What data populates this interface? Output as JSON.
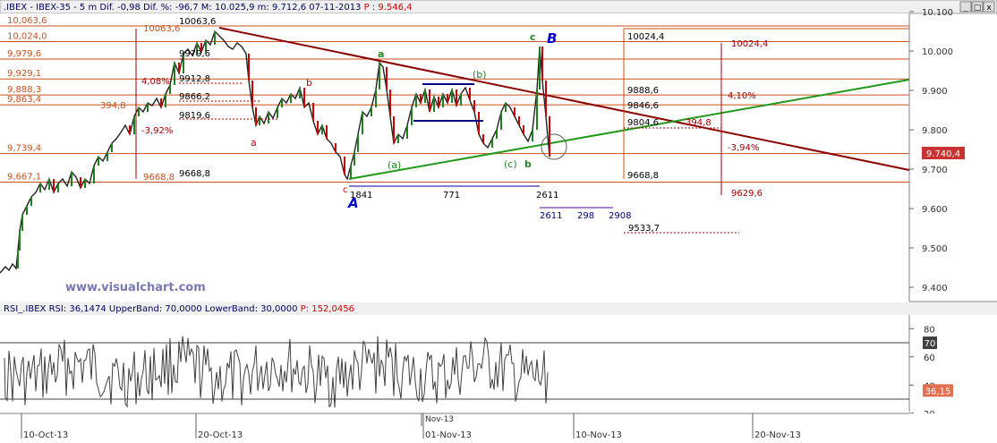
{
  "header": {
    "symbol": ".IBEX - IBEX-35",
    "timeframe": "5 m",
    "dif_label": "Dif.",
    "dif_value": "-0,98",
    "dif_pct_label": "Dif. %:",
    "dif_pct": "-96,7",
    "max_label": "M:",
    "max": "10.025,9",
    "min_label": "m:",
    "min": "9.712,6",
    "date": "07-11-2013",
    "p_label": "P :",
    "price": "9.546,4"
  },
  "window_buttons": [
    "_",
    "□",
    "x"
  ],
  "colors": {
    "up": "#0000c8",
    "down": "#c80000",
    "trend_red": "#8b0000",
    "trend_green": "#22991a",
    "axis_price": "#c83232",
    "watermark": "#7878b4"
  },
  "watermark": "www.visualchart.com",
  "price_axis": {
    "ticks": [
      "10.100",
      "10.000",
      "9.900",
      "9.800",
      "9.700",
      "9.600",
      "9.500",
      "9.400"
    ],
    "tick_values": [
      10100,
      10000,
      9900,
      9800,
      9700,
      9600,
      9500,
      9400
    ],
    "current": "9.740,4"
  },
  "date_axis": {
    "labels": [
      "10-Oct-13",
      "20-Oct-13",
      "01-Nov-13",
      "10-Nov-13",
      "20-Nov-13"
    ],
    "sub_label": "Nov-13"
  },
  "hlevels": [
    {
      "label": "10,063,6",
      "value": 10063.6
    },
    {
      "label": "10,024,0",
      "value": 10024.0
    },
    {
      "label": "9,979,6",
      "value": 9979.6
    },
    {
      "label": "9,929,1",
      "value": 9929.1
    },
    {
      "label": "9,888,3",
      "value": 9888.3
    },
    {
      "label": "9,863,4",
      "value": 9863.4
    },
    {
      "label": "9,739,4",
      "value": 9739.4
    },
    {
      "label": "9,667,1",
      "value": 9667.1
    }
  ],
  "annotations": {
    "l_10063": "10063,6",
    "l_10063b": "10063,6",
    "l_997": "9979,6",
    "l_9912": "9912,8",
    "l_9866": "9866,2",
    "l_9819": "9819,6",
    "l_9668": "9668,8",
    "l_9668b": "9668,8",
    "l_3948": "394,8",
    "l_408": "4,08%",
    "l_392": "-3,92%",
    "r_10024": "10024,4",
    "r_10024b": "10024,4",
    "r_9888": "9888,6",
    "r_410": "4,10%",
    "r_9846": "9846,6",
    "r_9804": "9804,6",
    "r_3948": "394,8",
    "r_394": "-3,94%",
    "r_9668": "9668,8",
    "r_9629": "9629,6",
    "r_9533": "9533,7",
    "m_1841": "1841",
    "m_771": "771",
    "m_2611": "2611",
    "m_2611b": "2611",
    "m_298": "298",
    "m_2908": "2908",
    "w_a": "a",
    "w_b": "b",
    "w_c": "c",
    "w_A": "A",
    "w_B": "B",
    "w_ga": "a",
    "w_gb": "b",
    "w_gc": "c",
    "w_pa": "(a)",
    "w_pb": "(b)",
    "w_pc": "(c)",
    "w_gb2": "b"
  },
  "rsi": {
    "title": "RSI_.IBEX RSI: 36,1474 UpperBand: 70,0000 LowerBand: 30,0000",
    "p_label": "P:",
    "p_value": "152,0456",
    "ticks": [
      "80",
      "60",
      "40",
      "20"
    ],
    "tick_values": [
      80,
      60,
      40,
      20
    ],
    "upper": "70",
    "lower": "30",
    "current": "36,15",
    "upper_value": 70,
    "lower_value": 30,
    "current_value": 36.15
  },
  "chart_data": {
    "type": "line",
    "x": [
      "10-Oct-13",
      "20-Oct-13",
      "01-Nov-13",
      "10-Nov-13",
      "20-Nov-13"
    ],
    "series": [
      {
        "name": ".IBEX",
        "values": [
          9420,
          9700,
          9980,
          9840,
          9700,
          9740
        ]
      }
    ],
    "ylim": [
      9380,
      10110
    ]
  }
}
